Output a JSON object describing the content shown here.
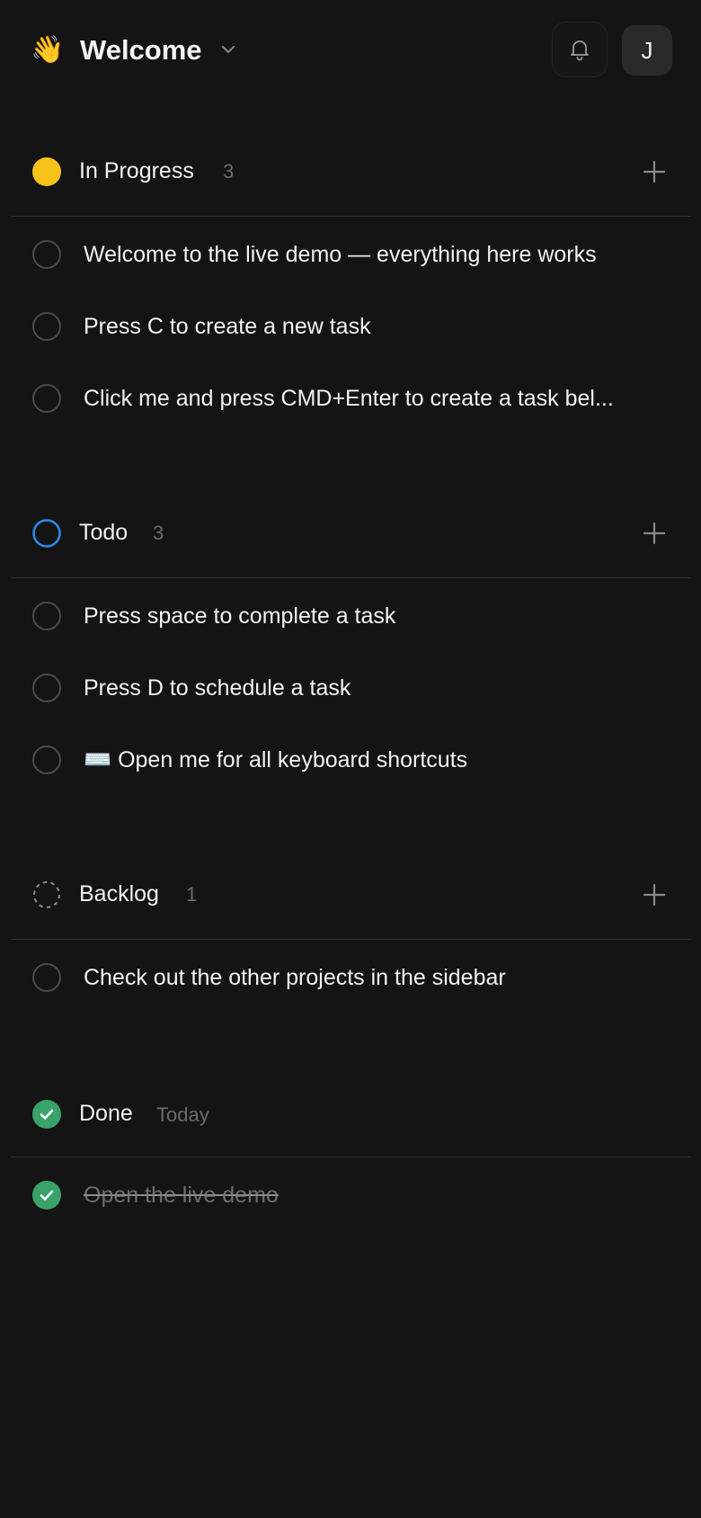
{
  "header": {
    "emoji": "👋",
    "title": "Welcome",
    "avatar_initial": "J",
    "icons": {
      "notifications": "bell-icon",
      "dropdown": "chevron-down-icon"
    }
  },
  "colors": {
    "in_progress": "#F7C21A",
    "todo": "#2B8CE8",
    "done": "#3AA36A",
    "background": "#141414"
  },
  "sections": [
    {
      "name": "In Progress",
      "count": "3",
      "tasks": [
        "Welcome to the live demo — everything here works",
        "Press C to create a new task",
        "Click me and press CMD+Enter to create a task bel..."
      ]
    },
    {
      "name": "Todo",
      "count": "3",
      "tasks": [
        "Press space to complete a task",
        "Press D to schedule a task",
        "⌨️ Open me for all keyboard shortcuts"
      ]
    },
    {
      "name": "Backlog",
      "count": "1",
      "tasks": [
        "Check out the other projects in the sidebar"
      ]
    },
    {
      "name": "Done",
      "count": "Today",
      "tasks": [
        "Open the live demo"
      ]
    }
  ]
}
